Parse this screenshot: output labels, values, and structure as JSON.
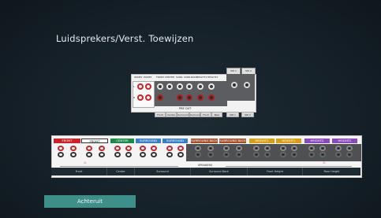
{
  "page": {
    "title": "Luidsprekers/Verst. Toewijzen"
  },
  "preout": {
    "top_labels": [
      "ZONE2",
      "ZONE3",
      "FRONT",
      "CENTER",
      "SURR.",
      "SURR.BACK",
      "HEIGHT1",
      "HEIGHT2"
    ],
    "side_labels": [
      "L",
      "R"
    ],
    "pre_out_label": "PRE OUT",
    "subwoofer_labels": [
      "SW 1",
      "SW 2"
    ],
    "bottom_tabs": [
      "Front",
      "Center",
      "Surround",
      "Surround Back",
      "Front Height",
      "Rear Height",
      "SW 1",
      "SW 2"
    ]
  },
  "speakers": {
    "headers": [
      {
        "label": "FRONT",
        "color": "#c8252a"
      },
      {
        "label": "FRONT",
        "color": "#ffffff"
      },
      {
        "label": "CENTER",
        "color": "#1e8a4a"
      },
      {
        "label": "SURROUND",
        "color": "#3a7fc1"
      },
      {
        "label": "SURROUND",
        "color": "#3a7fc1"
      },
      {
        "label": "SURROUND BACK",
        "color": "#a0522d"
      },
      {
        "label": "SURROUND BACK",
        "color": "#a0522d"
      },
      {
        "label": "HEIGHT1",
        "color": "#d4a017"
      },
      {
        "label": "HEIGHT1",
        "color": "#d4a017"
      },
      {
        "label": "HEIGHT2",
        "color": "#8a4bb8"
      },
      {
        "label": "HEIGHT2",
        "color": "#8a4bb8"
      }
    ],
    "speakers_label": "SPEAKERS",
    "bottom_labels": [
      "Front",
      "Center",
      "Surround",
      "Surround Back",
      "Front Height",
      "Rear Height"
    ]
  },
  "back_button": {
    "label": "Achteruit"
  },
  "colors": {
    "accent": "#3e8f8a",
    "background": "#162129"
  }
}
